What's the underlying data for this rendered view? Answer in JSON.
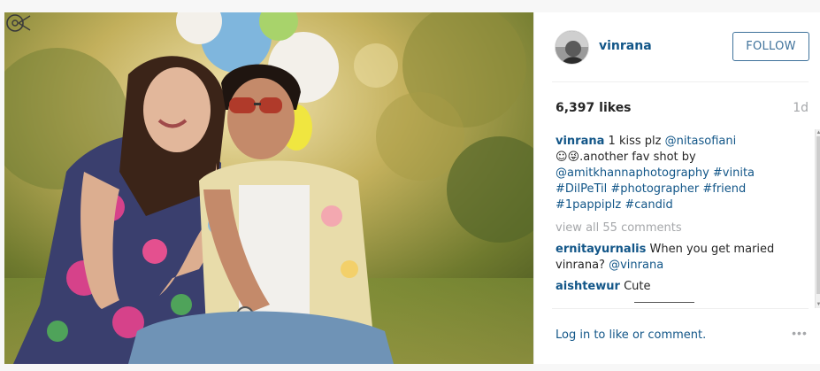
{
  "post": {
    "username": "vinrana",
    "follow_label": "FOLLOW",
    "likes": "6,397 likes",
    "time_ago": "1d",
    "caption": {
      "username": "vinrana",
      "line1_text": " 1 kiss plz ",
      "mention1": "@nitasofiani",
      "line2": "☺😜.another fav shot by",
      "mention2": "@amitkhannaphotography",
      "tag_vinita": "#vinita",
      "tag_dilpetil": "#DilPeTil",
      "tag_photographer": "#photographer",
      "tag_friend": "#friend",
      "tag_1pappiplz": "#1pappiplz",
      "tag_candid": "#candid"
    },
    "view_all": "view all 55 comments",
    "comments": [
      {
        "username": "ernitayurnalis",
        "text": " When you get maried vinrana? ",
        "mention": "@vinrana"
      },
      {
        "username": "aishtewur",
        "text": " Cute",
        "mention": ""
      }
    ],
    "login_text": "Log in to like or comment.",
    "more_label": "•••"
  },
  "colors": {
    "link": "#125688",
    "follow_border": "#3f729b",
    "muted": "#a5a7aa"
  }
}
